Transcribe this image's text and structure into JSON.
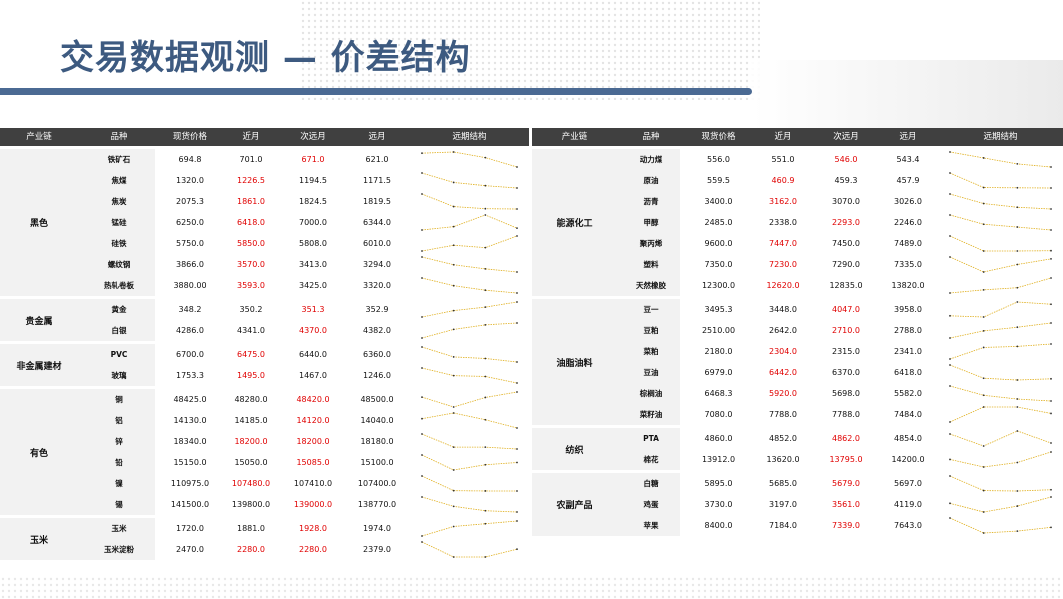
{
  "title": "交易数据观测 — 价差结构",
  "headers": [
    "产业链",
    "品种",
    "现货价格",
    "近月",
    "次远月",
    "远月",
    "远期结构"
  ],
  "left_groups": [
    {
      "name": "黑色",
      "rows": [
        {
          "item": "铁矿石",
          "spot": "694.8",
          "near": "701.0",
          "next": "671.0",
          "far": "621.0",
          "red": "next"
        },
        {
          "item": "焦煤",
          "spot": "1320.0",
          "near": "1226.5",
          "next": "1194.5",
          "far": "1171.5",
          "red": "near"
        },
        {
          "item": "焦炭",
          "spot": "2075.3",
          "near": "1861.0",
          "next": "1824.5",
          "far": "1819.5",
          "red": "near"
        },
        {
          "item": "锰硅",
          "spot": "6250.0",
          "near": "6418.0",
          "next": "7000.0",
          "far": "6344.0",
          "red": "near"
        },
        {
          "item": "硅铁",
          "spot": "5750.0",
          "near": "5850.0",
          "next": "5808.0",
          "far": "6010.0",
          "red": "near"
        },
        {
          "item": "螺纹钢",
          "spot": "3866.0",
          "near": "3570.0",
          "next": "3413.0",
          "far": "3294.0",
          "red": "near"
        },
        {
          "item": "热轧卷板",
          "spot": "3880.00",
          "near": "3593.0",
          "next": "3425.0",
          "far": "3320.0",
          "red": "near"
        }
      ]
    },
    {
      "name": "贵金属",
      "rows": [
        {
          "item": "黄金",
          "spot": "348.2",
          "near": "350.2",
          "next": "351.3",
          "far": "352.9",
          "red": "next"
        },
        {
          "item": "白银",
          "spot": "4286.0",
          "near": "4341.0",
          "next": "4370.0",
          "far": "4382.0",
          "red": "next"
        }
      ]
    },
    {
      "name": "非金属建材",
      "rows": [
        {
          "item": "PVC",
          "spot": "6700.0",
          "near": "6475.0",
          "next": "6440.0",
          "far": "6360.0",
          "red": "near"
        },
        {
          "item": "玻璃",
          "spot": "1753.3",
          "near": "1495.0",
          "next": "1467.0",
          "far": "1246.0",
          "red": "near"
        }
      ]
    },
    {
      "name": "有色",
      "rows": [
        {
          "item": "铜",
          "spot": "48425.0",
          "near": "48280.0",
          "next": "48420.0",
          "far": "48500.0",
          "red": "next"
        },
        {
          "item": "铝",
          "spot": "14130.0",
          "near": "14185.0",
          "next": "14120.0",
          "far": "14040.0",
          "red": "next"
        },
        {
          "item": "锌",
          "spot": "18340.0",
          "near": "18200.0",
          "next": "18200.0",
          "far": "18180.0",
          "red": "both"
        },
        {
          "item": "铅",
          "spot": "15150.0",
          "near": "15050.0",
          "next": "15085.0",
          "far": "15100.0",
          "red": "next"
        },
        {
          "item": "镍",
          "spot": "110975.0",
          "near": "107480.0",
          "next": "107410.0",
          "far": "107400.0",
          "red": "near"
        },
        {
          "item": "锡",
          "spot": "141500.0",
          "near": "139800.0",
          "next": "139000.0",
          "far": "138770.0",
          "red": "next"
        }
      ]
    },
    {
      "name": "玉米",
      "rows": [
        {
          "item": "玉米",
          "spot": "1720.0",
          "near": "1881.0",
          "next": "1928.0",
          "far": "1974.0",
          "red": "next"
        },
        {
          "item": "玉米淀粉",
          "spot": "2470.0",
          "near": "2280.0",
          "next": "2280.0",
          "far": "2379.0",
          "red": "both"
        }
      ]
    }
  ],
  "right_groups": [
    {
      "name": "能源化工",
      "rows": [
        {
          "item": "动力煤",
          "spot": "556.0",
          "near": "551.0",
          "next": "546.0",
          "far": "543.4",
          "red": "next"
        },
        {
          "item": "原油",
          "spot": "559.5",
          "near": "460.9",
          "next": "459.3",
          "far": "457.9",
          "red": "near"
        },
        {
          "item": "沥青",
          "spot": "3400.0",
          "near": "3162.0",
          "next": "3070.0",
          "far": "3026.0",
          "red": "near"
        },
        {
          "item": "甲醇",
          "spot": "2485.0",
          "near": "2338.0",
          "next": "2293.0",
          "far": "2246.0",
          "red": "next"
        },
        {
          "item": "聚丙烯",
          "spot": "9600.0",
          "near": "7447.0",
          "next": "7450.0",
          "far": "7489.0",
          "red": "near"
        },
        {
          "item": "塑料",
          "spot": "7350.0",
          "near": "7230.0",
          "next": "7290.0",
          "far": "7335.0",
          "red": "near"
        },
        {
          "item": "天然橡胶",
          "spot": "12300.0",
          "near": "12620.0",
          "next": "12835.0",
          "far": "13820.0",
          "red": "near"
        }
      ]
    },
    {
      "name": "油脂油料",
      "rows": [
        {
          "item": "豆一",
          "spot": "3495.3",
          "near": "3448.0",
          "next": "4047.0",
          "far": "3958.0",
          "red": "next"
        },
        {
          "item": "豆粕",
          "spot": "2510.00",
          "near": "2642.0",
          "next": "2710.0",
          "far": "2788.0",
          "red": "next"
        },
        {
          "item": "菜粕",
          "spot": "2180.0",
          "near": "2304.0",
          "next": "2315.0",
          "far": "2341.0",
          "red": "near"
        },
        {
          "item": "豆油",
          "spot": "6979.0",
          "near": "6442.0",
          "next": "6370.0",
          "far": "6418.0",
          "red": "near"
        },
        {
          "item": "棕榈油",
          "spot": "6468.3",
          "near": "5920.0",
          "next": "5698.0",
          "far": "5582.0",
          "red": "near"
        },
        {
          "item": "菜籽油",
          "spot": "7080.0",
          "near": "7788.0",
          "next": "7788.0",
          "far": "7484.0",
          "red": "none"
        }
      ]
    },
    {
      "name": "纺织",
      "rows": [
        {
          "item": "PTA",
          "spot": "4860.0",
          "near": "4852.0",
          "next": "4862.0",
          "far": "4854.0",
          "red": "next"
        },
        {
          "item": "棉花",
          "spot": "13912.0",
          "near": "13620.0",
          "next": "13795.0",
          "far": "14200.0",
          "red": "next"
        }
      ]
    },
    {
      "name": "农副产品",
      "rows": [
        {
          "item": "白糖",
          "spot": "5895.0",
          "near": "5685.0",
          "next": "5679.0",
          "far": "5697.0",
          "red": "next"
        },
        {
          "item": "鸡蛋",
          "spot": "3730.0",
          "near": "3197.0",
          "next": "3561.0",
          "far": "4119.0",
          "red": "next"
        },
        {
          "item": "苹果",
          "spot": "8400.0",
          "near": "7184.0",
          "next": "7339.0",
          "far": "7643.0",
          "red": "next"
        }
      ]
    }
  ],
  "colors": {
    "red": "#e00000",
    "spark": "#e0b020",
    "header": "#404040",
    "title": "#3d5a80"
  }
}
